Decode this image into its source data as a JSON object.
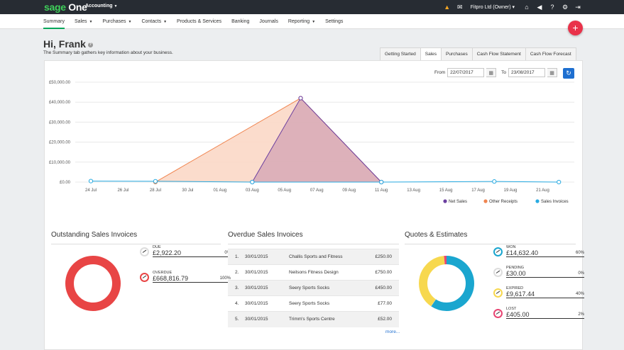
{
  "topbar": {
    "logo_prefix": "sage",
    "logo_suffix": " One",
    "product": "Accounting",
    "company": "Fitpro Ltd (Owner)",
    "icons": [
      "notifications-icon",
      "mail-icon",
      "home-icon",
      "announcements-icon",
      "help-icon",
      "settings-icon",
      "logout-icon"
    ]
  },
  "nav": {
    "items": [
      {
        "label": "Summary",
        "active": true,
        "dropdown": false
      },
      {
        "label": "Sales",
        "dropdown": true
      },
      {
        "label": "Purchases",
        "dropdown": true
      },
      {
        "label": "Contacts",
        "dropdown": true
      },
      {
        "label": "Products & Services",
        "dropdown": false
      },
      {
        "label": "Banking",
        "dropdown": false
      },
      {
        "label": "Journals",
        "dropdown": false
      },
      {
        "label": "Reporting",
        "dropdown": true
      },
      {
        "label": "Settings",
        "dropdown": false
      }
    ]
  },
  "page": {
    "greeting": "Hi, Frank",
    "subtitle": "The Summary tab gathers key information about your business."
  },
  "tabs": [
    {
      "label": "Getting Started"
    },
    {
      "label": "Sales",
      "selected": true
    },
    {
      "label": "Purchases"
    },
    {
      "label": "Cash Flow Statement"
    },
    {
      "label": "Cash Flow Forecast"
    }
  ],
  "filters": {
    "from_label": "From",
    "from_value": "22/07/2017",
    "to_label": "To",
    "to_value": "23/08/2017"
  },
  "chart_data": {
    "type": "area",
    "y_ticks": [
      "£50,000.00",
      "£40,000.00",
      "£30,000.00",
      "£20,000.00",
      "£10,000.00",
      "£0.00"
    ],
    "ylim": [
      0,
      50000
    ],
    "x_ticks": [
      "24 Jul",
      "26 Jul",
      "28 Jul",
      "30 Jul",
      "01 Aug",
      "03 Aug",
      "05 Aug",
      "07 Aug",
      "09 Aug",
      "11 Aug",
      "13 Aug",
      "15 Aug",
      "17 Aug",
      "19 Aug",
      "21 Aug"
    ],
    "series": [
      {
        "name": "Net Sales",
        "color": "#6b3fa0",
        "fill": "#d7a9b6",
        "x": [
          "03 Aug",
          "06 Aug",
          "11 Aug"
        ],
        "values": [
          0,
          42000,
          0
        ]
      },
      {
        "name": "Other Receipts",
        "color": "#f08550",
        "fill": "#fbd8c6",
        "x": [
          "28 Jul",
          "06 Aug",
          "11 Aug"
        ],
        "values": [
          0,
          42000,
          0
        ]
      },
      {
        "name": "Sales Invoices",
        "color": "#29abe2",
        "x": [
          "24 Jul",
          "28 Jul",
          "03 Aug",
          "11 Aug",
          "18 Aug",
          "22 Aug"
        ],
        "values": [
          500,
          400,
          0,
          0,
          300,
          0
        ]
      }
    ],
    "legend_position": "bottom-right"
  },
  "outstanding": {
    "title": "Outstanding Sales Invoices",
    "items": [
      {
        "label": "DUE",
        "value": "£2,922.20",
        "pct": "0%",
        "color": "#dddddd"
      },
      {
        "label": "OVERDUE",
        "value": "£668,816.79",
        "pct": "100%",
        "color": "#e84545"
      }
    ]
  },
  "overdue": {
    "title": "Overdue Sales Invoices",
    "rows": [
      {
        "num": "1.",
        "date": "30/01/2015",
        "name": "Challis Sports and Fitness",
        "amount": "£250.00"
      },
      {
        "num": "2.",
        "date": "30/01/2015",
        "name": "Neilsons Fitness Design",
        "amount": "£750.00"
      },
      {
        "num": "3.",
        "date": "30/01/2015",
        "name": "Seery Sports Socks",
        "amount": "£450.00"
      },
      {
        "num": "4.",
        "date": "30/01/2015",
        "name": "Seery Sports Socks",
        "amount": "£77.00"
      },
      {
        "num": "5.",
        "date": "30/01/2015",
        "name": "Trimm's Sports Centre",
        "amount": "£52.00"
      }
    ],
    "more": "more..."
  },
  "quotes": {
    "title": "Quotes & Estimates",
    "items": [
      {
        "label": "WON",
        "value": "£14,632.40",
        "pct": "60%",
        "color": "#1aa6cf"
      },
      {
        "label": "PENDING",
        "value": "£30.00",
        "pct": "0%",
        "color": "#dddddd"
      },
      {
        "label": "EXPIRED",
        "value": "£9,617.44",
        "pct": "40%",
        "color": "#f7d84f"
      },
      {
        "label": "LOST",
        "value": "£405.00",
        "pct": "2%",
        "color": "#e84573"
      }
    ]
  }
}
